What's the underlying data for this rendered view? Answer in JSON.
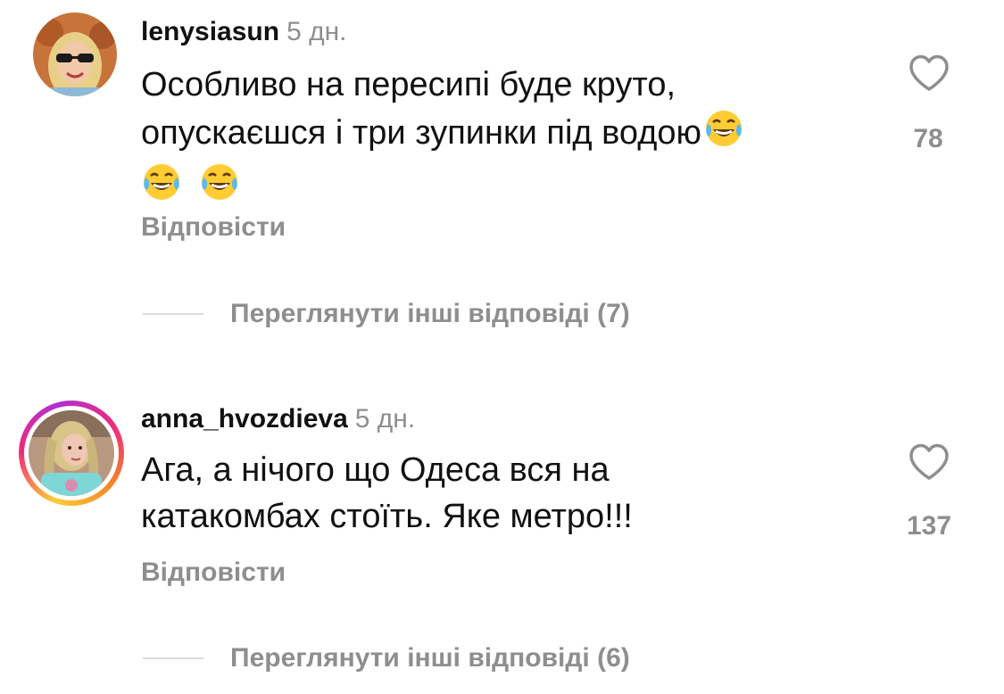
{
  "comments": [
    {
      "username": "lenysiasun",
      "time": "5 дн.",
      "text_line1": "Особливо на пересипі буде круто,",
      "text_line2": "опускаєшся і три зупинки під водою",
      "emoji_name": "face-with-tears-of-joy",
      "emoji_char": "😂",
      "reply_label": "Відповісти",
      "likes": "78",
      "view_replies": "Переглянути інші відповіді (7)",
      "has_story_ring": false
    },
    {
      "username": "anna_hvozdieva",
      "time": "5 дн.",
      "text_line1": "Ага, а нічого що Одеса вся на",
      "text_line2": "катакомбах стоїть. Яке метро!!!",
      "reply_label": "Відповісти",
      "likes": "137",
      "view_replies": "Переглянути інші відповіді (6)",
      "has_story_ring": true
    }
  ],
  "colors": {
    "text": "#111111",
    "secondary": "#8e8e8e",
    "divider": "#dbdbdb",
    "story_ring": [
      "#f9ce34",
      "#ee2a7b",
      "#b02fd5",
      "#f58529"
    ]
  },
  "icons": {
    "like": "heart-outline-icon"
  }
}
